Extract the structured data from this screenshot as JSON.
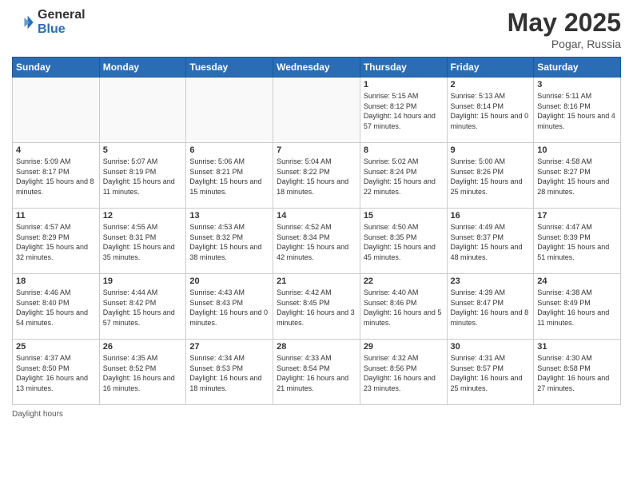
{
  "header": {
    "logo_general": "General",
    "logo_blue": "Blue",
    "title": "May 2025",
    "location": "Pogar, Russia"
  },
  "weekdays": [
    "Sunday",
    "Monday",
    "Tuesday",
    "Wednesday",
    "Thursday",
    "Friday",
    "Saturday"
  ],
  "footer": "Daylight hours",
  "weeks": [
    [
      {
        "day": "",
        "empty": true
      },
      {
        "day": "",
        "empty": true
      },
      {
        "day": "",
        "empty": true
      },
      {
        "day": "",
        "empty": true
      },
      {
        "day": "1",
        "sunrise": "5:15 AM",
        "sunset": "8:12 PM",
        "daylight": "14 hours and 57 minutes."
      },
      {
        "day": "2",
        "sunrise": "5:13 AM",
        "sunset": "8:14 PM",
        "daylight": "15 hours and 0 minutes."
      },
      {
        "day": "3",
        "sunrise": "5:11 AM",
        "sunset": "8:16 PM",
        "daylight": "15 hours and 4 minutes."
      }
    ],
    [
      {
        "day": "4",
        "sunrise": "5:09 AM",
        "sunset": "8:17 PM",
        "daylight": "15 hours and 8 minutes."
      },
      {
        "day": "5",
        "sunrise": "5:07 AM",
        "sunset": "8:19 PM",
        "daylight": "15 hours and 11 minutes."
      },
      {
        "day": "6",
        "sunrise": "5:06 AM",
        "sunset": "8:21 PM",
        "daylight": "15 hours and 15 minutes."
      },
      {
        "day": "7",
        "sunrise": "5:04 AM",
        "sunset": "8:22 PM",
        "daylight": "15 hours and 18 minutes."
      },
      {
        "day": "8",
        "sunrise": "5:02 AM",
        "sunset": "8:24 PM",
        "daylight": "15 hours and 22 minutes."
      },
      {
        "day": "9",
        "sunrise": "5:00 AM",
        "sunset": "8:26 PM",
        "daylight": "15 hours and 25 minutes."
      },
      {
        "day": "10",
        "sunrise": "4:58 AM",
        "sunset": "8:27 PM",
        "daylight": "15 hours and 28 minutes."
      }
    ],
    [
      {
        "day": "11",
        "sunrise": "4:57 AM",
        "sunset": "8:29 PM",
        "daylight": "15 hours and 32 minutes."
      },
      {
        "day": "12",
        "sunrise": "4:55 AM",
        "sunset": "8:31 PM",
        "daylight": "15 hours and 35 minutes."
      },
      {
        "day": "13",
        "sunrise": "4:53 AM",
        "sunset": "8:32 PM",
        "daylight": "15 hours and 38 minutes."
      },
      {
        "day": "14",
        "sunrise": "4:52 AM",
        "sunset": "8:34 PM",
        "daylight": "15 hours and 42 minutes."
      },
      {
        "day": "15",
        "sunrise": "4:50 AM",
        "sunset": "8:35 PM",
        "daylight": "15 hours and 45 minutes."
      },
      {
        "day": "16",
        "sunrise": "4:49 AM",
        "sunset": "8:37 PM",
        "daylight": "15 hours and 48 minutes."
      },
      {
        "day": "17",
        "sunrise": "4:47 AM",
        "sunset": "8:39 PM",
        "daylight": "15 hours and 51 minutes."
      }
    ],
    [
      {
        "day": "18",
        "sunrise": "4:46 AM",
        "sunset": "8:40 PM",
        "daylight": "15 hours and 54 minutes."
      },
      {
        "day": "19",
        "sunrise": "4:44 AM",
        "sunset": "8:42 PM",
        "daylight": "15 hours and 57 minutes."
      },
      {
        "day": "20",
        "sunrise": "4:43 AM",
        "sunset": "8:43 PM",
        "daylight": "16 hours and 0 minutes."
      },
      {
        "day": "21",
        "sunrise": "4:42 AM",
        "sunset": "8:45 PM",
        "daylight": "16 hours and 3 minutes."
      },
      {
        "day": "22",
        "sunrise": "4:40 AM",
        "sunset": "8:46 PM",
        "daylight": "16 hours and 5 minutes."
      },
      {
        "day": "23",
        "sunrise": "4:39 AM",
        "sunset": "8:47 PM",
        "daylight": "16 hours and 8 minutes."
      },
      {
        "day": "24",
        "sunrise": "4:38 AM",
        "sunset": "8:49 PM",
        "daylight": "16 hours and 11 minutes."
      }
    ],
    [
      {
        "day": "25",
        "sunrise": "4:37 AM",
        "sunset": "8:50 PM",
        "daylight": "16 hours and 13 minutes."
      },
      {
        "day": "26",
        "sunrise": "4:35 AM",
        "sunset": "8:52 PM",
        "daylight": "16 hours and 16 minutes."
      },
      {
        "day": "27",
        "sunrise": "4:34 AM",
        "sunset": "8:53 PM",
        "daylight": "16 hours and 18 minutes."
      },
      {
        "day": "28",
        "sunrise": "4:33 AM",
        "sunset": "8:54 PM",
        "daylight": "16 hours and 21 minutes."
      },
      {
        "day": "29",
        "sunrise": "4:32 AM",
        "sunset": "8:56 PM",
        "daylight": "16 hours and 23 minutes."
      },
      {
        "day": "30",
        "sunrise": "4:31 AM",
        "sunset": "8:57 PM",
        "daylight": "16 hours and 25 minutes."
      },
      {
        "day": "31",
        "sunrise": "4:30 AM",
        "sunset": "8:58 PM",
        "daylight": "16 hours and 27 minutes."
      }
    ]
  ]
}
